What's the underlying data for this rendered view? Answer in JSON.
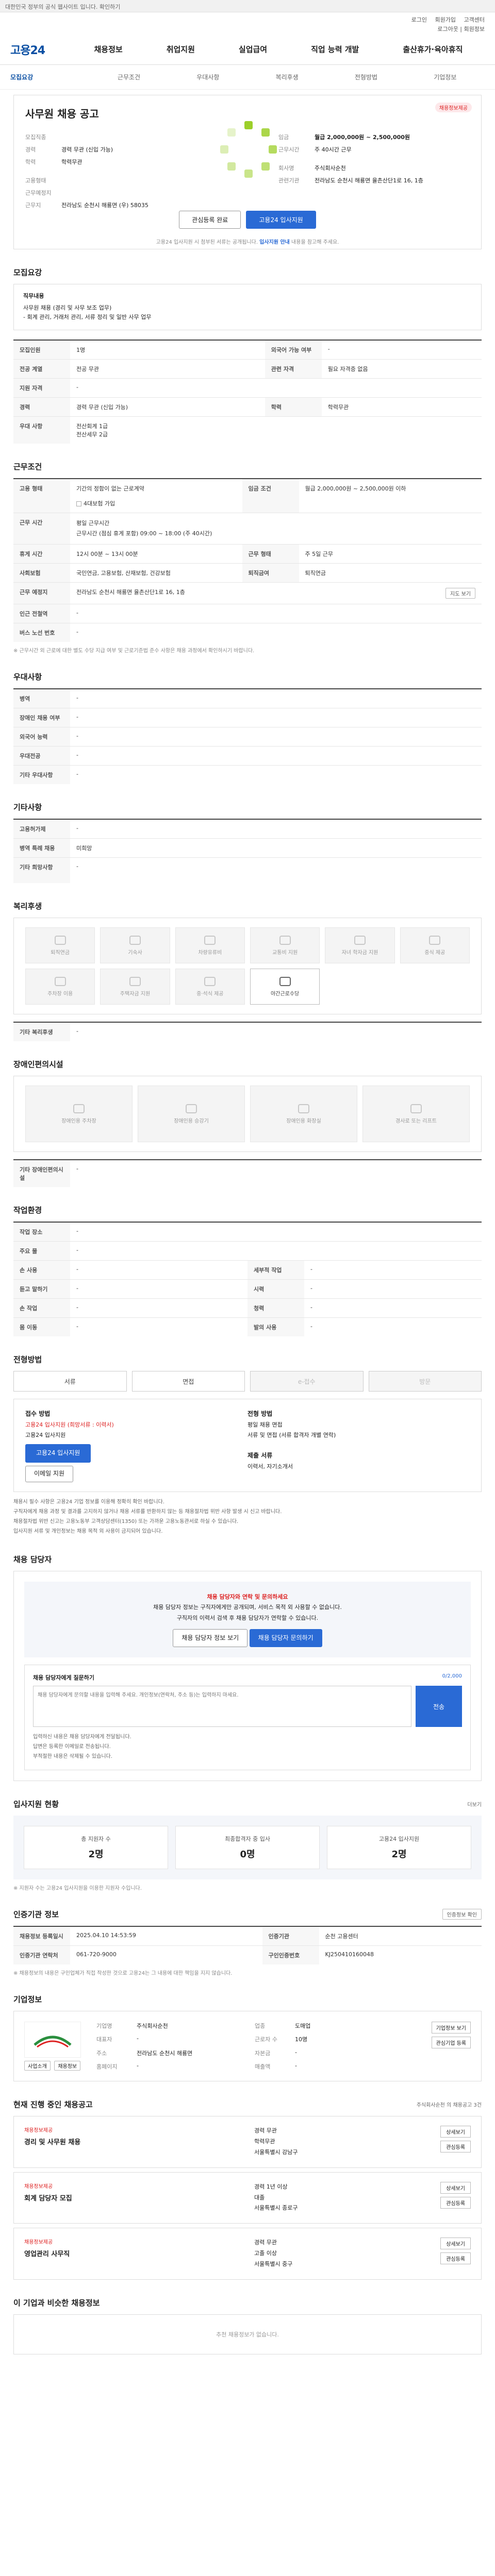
{
  "topbar": {
    "text": "대한민국 정부의 공식 웹사이트 입니다. 확인하기"
  },
  "util": {
    "links": [
      "로그인",
      "회원가입",
      "고객센터"
    ],
    "member": "로그아웃 | 회원정보"
  },
  "brand": {
    "logo": "고용24"
  },
  "gnb": [
    "채용정보",
    "취업지원",
    "실업급여",
    "직업 능력 개발",
    "출산휴가·육아휴직"
  ],
  "tabs": [
    "모집요강",
    "근무조건",
    "우대사항",
    "복리후생",
    "전형방법",
    "기업정보"
  ],
  "head": {
    "title": "사무원 채용 공고",
    "share": "채용정보제공",
    "left_keys": [
      "모집직종",
      "경력",
      "학력",
      "고용형태",
      "근무예정지",
      "근무지"
    ],
    "left_vals": [
      "",
      "경력 무관 (신입 가능)",
      "학력무관",
      "",
      "",
      "전라남도 순천시 해룡면 (우) 58035"
    ],
    "right_keys": [
      "",
      "임금",
      "",
      "",
      "근무시간",
      "회사명"
    ],
    "right_vals": [
      "",
      "",
      "",
      "",
      "주 40시간 근무",
      "주식회사순천"
    ],
    "detail1": "월급 2,000,000원 ~ 2,500,000원",
    "detail2": "전라남도 순천시 해룡면 율촌산단1로 16, 1층",
    "detail3": "관련기관",
    "btn_interest": "관심등록 완료",
    "btn_apply": "고용24 입사지원",
    "notice_a": "고용24 입사지원 시 첨부된 서류는 공개됩니다. ",
    "notice_b": "입사지원 안내",
    "notice_c": " 내용을 참고해 주세요."
  },
  "recruit": {
    "title": "모집요강",
    "intro_label": "직무내용",
    "intro_body": "사무원 채용 (경리 및 사무 보조 업무)\n- 회계 관리, 거래처 관리, 서류 정리 및 일반 사무 업무",
    "rows": [
      {
        "k": "모집인원",
        "v": "1명",
        "k2": "외국어 가능 여부",
        "v2": "-"
      },
      {
        "k": "전공 계열",
        "v": "전공 무관",
        "k2": "관련 자격",
        "v2": "필요 자격증 없음"
      },
      {
        "k": "지원 자격",
        "v": "-",
        "k2": "",
        "v2": ""
      },
      {
        "k": "경력",
        "v": "경력 무관 (신입 가능)",
        "k2": "학력",
        "v2": "학력무관"
      },
      {
        "k": "우대 사항",
        "v": "전산회계 1급\n전산세무 2급",
        "k2": "",
        "v2": ""
      }
    ]
  },
  "work": {
    "title": "근무조건",
    "rows": [
      {
        "k": "고용 형태",
        "v": "기간의 정함이 없는 근로계약",
        "k2": "임금 조건",
        "v2": "월급 2,000,000원 ~ 2,500,000원 이하"
      },
      {
        "k": "",
        "v": "4대보험 가입",
        "k2": "",
        "v2": ""
      },
      {
        "k": "근무 시간",
        "v": "평일 근무시간\n근무시간 (점심 휴게 포함) 09:00 ~ 18:00 (주 40시간)",
        "k2": "",
        "v2": ""
      },
      {
        "k": "휴게 시간",
        "v": "12시 00분 ~ 13시 00분",
        "k2": "근무 형태",
        "v2": "주 5일 근무"
      },
      {
        "k": "사회보험",
        "v": "국민연금, 고용보험, 산재보험, 건강보험",
        "k2": "퇴직금여",
        "v2": "퇴직연금"
      },
      {
        "k": "근무 예정지",
        "v": "전라남도 순천시 해룡면 율촌산단1로 16, 1층",
        "k2": "",
        "v2": ""
      },
      {
        "k": "인근 전철역",
        "v": "-",
        "k2": "",
        "v2": ""
      },
      {
        "k": "버스 노선 번호",
        "v": "-",
        "k2": "",
        "v2": ""
      }
    ],
    "map_btn": "지도 보기",
    "note": "※ 근무시간 외 근로에 대한 별도 수당 지급 여부 및 근로기준법 준수 사항은 채용 과정에서 확인하시기 바랍니다."
  },
  "pref": {
    "title": "우대사항",
    "rows": [
      {
        "k": "병역",
        "v": "-"
      },
      {
        "k": "장애인 채용 여부",
        "v": "-"
      },
      {
        "k": "외국어 능력",
        "v": "-"
      },
      {
        "k": "우대전공",
        "v": "-"
      },
      {
        "k": "기타 우대사항",
        "v": "-"
      }
    ]
  },
  "etc": {
    "title": "기타사항",
    "rows": [
      {
        "k": "고용허가제",
        "v": "-"
      },
      {
        "k": "병역 특례 채용",
        "v": "미희망"
      },
      {
        "k": "기타 희망사항",
        "v": "-"
      }
    ]
  },
  "welfare": {
    "title": "복리후생",
    "items": [
      "퇴직연금",
      "기숙사",
      "차량유류비",
      "교통비 지원",
      "자녀 학자금 지원",
      "중식 제공",
      "주차장 이용",
      "주택자금 지원",
      "중·석식 제공",
      "야간근로수당"
    ],
    "on_index": 9,
    "extra_label": "기타 복리후생",
    "extra_value": "-"
  },
  "disabled": {
    "title": "장애인편의시설",
    "items": [
      "장애인용 주차장",
      "장애인용 승강기",
      "장애인용 화장실",
      "경사로 또는 리프트"
    ],
    "extra_label": "기타 장애인편의시설",
    "extra_value": "-"
  },
  "env": {
    "title": "작업환경",
    "rows": [
      {
        "k": "작업 장소",
        "v": "-",
        "k2": "",
        "v2": ""
      },
      {
        "k": "주요 물",
        "v": "-",
        "k2": "",
        "v2": ""
      },
      {
        "k": "손 사용",
        "v": "-",
        "k2": "세부적 작업",
        "v2": "-"
      },
      {
        "k": "듣고 말하기",
        "v": "-",
        "k2": "시력",
        "v2": "-"
      },
      {
        "k": "손 작업",
        "v": "-",
        "k2": "청력",
        "v2": "-"
      },
      {
        "k": "몸 이동",
        "v": "-",
        "k2": "발의 사용",
        "v2": "-"
      }
    ]
  },
  "select": {
    "title": "전형방법",
    "apply": [
      "서류",
      "면접",
      "e-접수",
      "방문"
    ],
    "apply_disabled": [
      false,
      false,
      true,
      true
    ],
    "left_title": "접수 방법",
    "left_lines": [
      "고용24 입사지원 (희망서류 : 이력서)",
      "고용24 입사지원"
    ],
    "left_btn": "고용24 입사지원",
    "left_btn2": "이메일 지원",
    "right_title": "전형 방법",
    "right_lines": [
      "평일 채용 면접",
      "서류 및 면접 (서류 합격자 개별 연락)"
    ],
    "right_title2": "제출 서류",
    "right_lines2": [
      "이력서, 자기소개서"
    ],
    "bullets": [
      "채용시 필수 사항은 고용24 기업 정보를 이용해 정확히 확인 바랍니다.",
      "구직자에게 채용 과정 및 결과를 고지하지 않거나 채용 서류를 반환하지 않는 등 채용절차법 위반 사항 발생 시 신고 바랍니다.",
      "채용절차법 위반 신고는 고용노동부 고객상담센터(1350) 또는 가까운 고용노동관서로 하실 수 있습니다.",
      "입사지원 서류 및 개인정보는 채용 목적 외 사용이 금지되어 있습니다."
    ]
  },
  "manager": {
    "title": "채용 담당자",
    "line1": "채용 담당자와 연락 및 문의하세요",
    "line2": "채용 담당자 정보는 구직자에게만 공개되며, 서비스 목적 외 사용할 수 없습니다.",
    "line3": "구직자의 이력서 검색 후 채용 담당자가 연락할 수 있습니다.",
    "btn1": "채용 담당자 정보 보기",
    "btn2": "채용 담당자 문의하기",
    "inquiry_label": "채용 담당자에게 질문하기",
    "inquiry_count": "0/2,000",
    "placeholder": "채용 담당자에게 문의할 내용을 입력해 주세요. 개인정보(연락처, 주소 등)는 입력하지 마세요.",
    "send": "전송",
    "notes": [
      "입력하신 내용은 채용 담당자에게 전달됩니다.",
      "답변은 등록한 이메일로 전송됩니다.",
      "부적절한 내용은 삭제될 수 있습니다."
    ]
  },
  "stats": {
    "title": "입사지원 현황",
    "more": "더보기",
    "items": [
      {
        "l": "총 지원자 수",
        "n": "2명"
      },
      {
        "l": "최종합격자 중 입사",
        "n": "0명"
      },
      {
        "l": "고용24 입사지원",
        "n": "2명"
      }
    ],
    "note": "※ 지원자 수는 고용24 입사지원을 이용한 지원자 수입니다."
  },
  "info": {
    "title": "인증기관 정보",
    "btn": "인증정보 확인",
    "rows": [
      {
        "k": "채용정보 등록일시",
        "v": "2025.04.10 14:53:59",
        "k2": "인증기관",
        "v2": "순천 고용센터"
      },
      {
        "k": "인증기관 연락처",
        "v": "061-720-9000",
        "k2": "구인인증번호",
        "v2": "KJ250410160048"
      }
    ],
    "note": "※ 채용정보의 내용은 구인업체가 직접 작성한 것으로 고용24는 그 내용에 대한 책임을 지지 않습니다."
  },
  "corp": {
    "title": "기업정보",
    "name": "주식회사순천",
    "rows": [
      {
        "k": "기업명",
        "v": "주식회사순천",
        "k2": "업종",
        "v2": "도매업"
      },
      {
        "k": "대표자",
        "v": "-",
        "k2": "근로자 수",
        "v2": "10명"
      },
      {
        "k": "주소",
        "v": "전라남도 순천시 해룡면",
        "k2": "자본금",
        "v2": "-"
      },
      {
        "k": "홈페이지",
        "v": "-",
        "k2": "매출액",
        "v2": "-"
      }
    ],
    "btns": [
      "기업정보 보기",
      "관심기업 등록"
    ],
    "logo_btns": [
      "사업소개",
      "채용정보"
    ]
  },
  "jobs": {
    "title": "현재 진행 중인 채용공고",
    "right": "주식회사순천 의 채용공고 3건",
    "items": [
      {
        "tag": "채용정보제공",
        "title": "경리 및 사무원 채용",
        "lines": [
          "경력 무관",
          "학력무관",
          "서울특별시 강남구"
        ],
        "btns": [
          "상세보기",
          "관심등록"
        ]
      },
      {
        "tag": "채용정보제공",
        "title": "회계 담당자 모집",
        "lines": [
          "경력 1년 이상",
          "대졸",
          "서울특별시 종로구"
        ],
        "btns": [
          "상세보기",
          "관심등록"
        ]
      },
      {
        "tag": "채용정보제공",
        "title": "영업관리 사무직",
        "lines": [
          "경력 무관",
          "고졸 이상",
          "서울특별시 중구"
        ],
        "btns": [
          "상세보기",
          "관심등록"
        ]
      }
    ]
  },
  "recom": {
    "title": "이 기업과 비슷한 채용정보",
    "empty": "추천 채용정보가 없습니다."
  }
}
